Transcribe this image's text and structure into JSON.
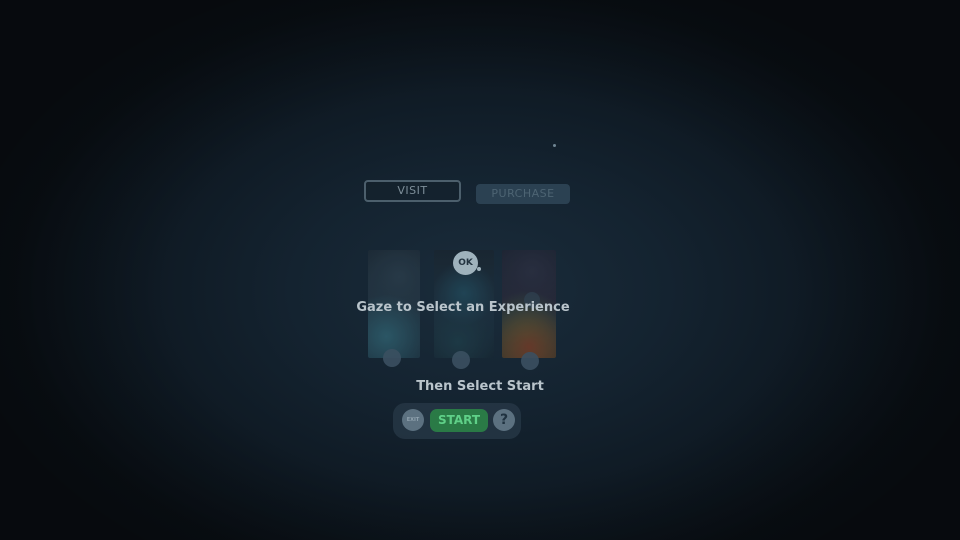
{
  "top_buttons": {
    "visit_label": "VISIT",
    "purchase_label": "PURCHASE"
  },
  "selector": {
    "ok_label": "OK",
    "gaze_instruction": "Gaze to Select an Experience",
    "start_instruction": "Then Select Start",
    "experiences": [
      {
        "name": "experience-1"
      },
      {
        "name": "experience-2"
      },
      {
        "name": "experience-3"
      }
    ]
  },
  "controls": {
    "exit_label": "EXIT",
    "start_label": "START",
    "help_label": "?"
  },
  "colors": {
    "background": "#142330",
    "start_green": "#2a7a46",
    "start_text": "#5fd088"
  },
  "icons": {
    "help": "question-mark-icon",
    "ok": "ok-badge-icon"
  }
}
